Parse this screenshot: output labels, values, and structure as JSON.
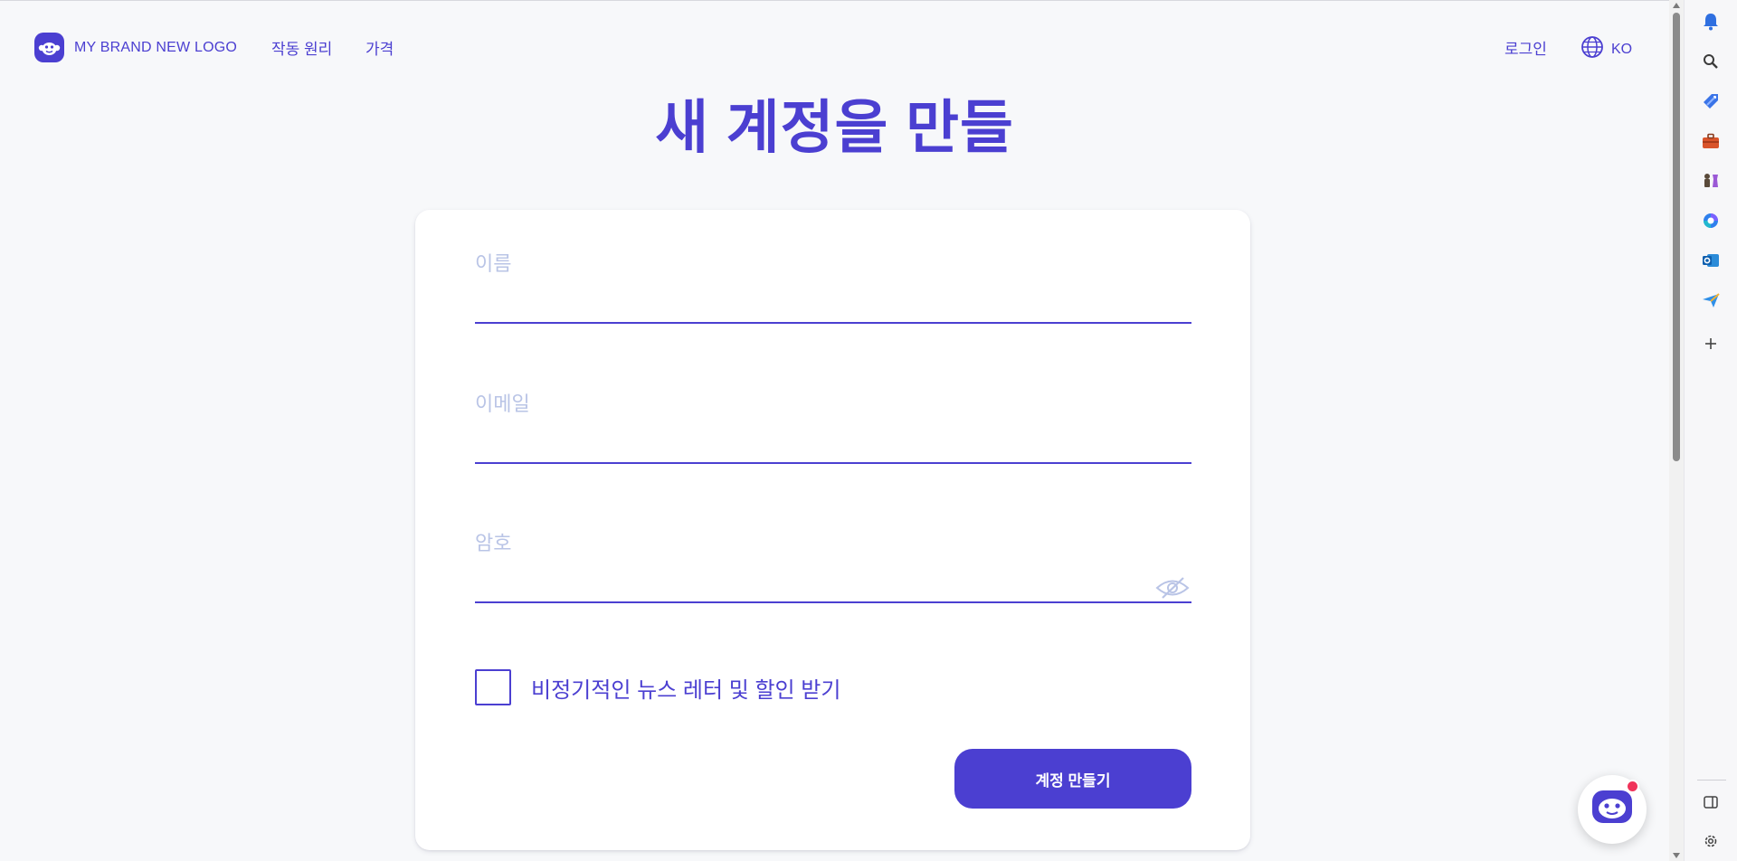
{
  "header": {
    "brand": "MY BRAND NEW LOGO",
    "nav": [
      "작동 원리",
      "가격"
    ],
    "login": "로그인",
    "lang": "KO"
  },
  "page_title": "새 계정을 만들",
  "form": {
    "name_label": "이름",
    "email_label": "이메일",
    "password_label": "암호",
    "newsletter_label": "비정기적인 뉴스 레터 및 할인 받기",
    "submit_label": "계정 만들기"
  },
  "colors": {
    "accent": "#4b3fd1",
    "label": "#b9c4e6",
    "background": "#f7f8fa",
    "notification_dot": "#f0335a"
  },
  "sidebar_icons": [
    "bell-icon",
    "search-icon",
    "tag-icon",
    "briefcase-icon",
    "chess-icon",
    "copilot-icon",
    "outlook-icon",
    "send-icon",
    "plus-icon",
    "split-view-icon",
    "gear-icon"
  ]
}
